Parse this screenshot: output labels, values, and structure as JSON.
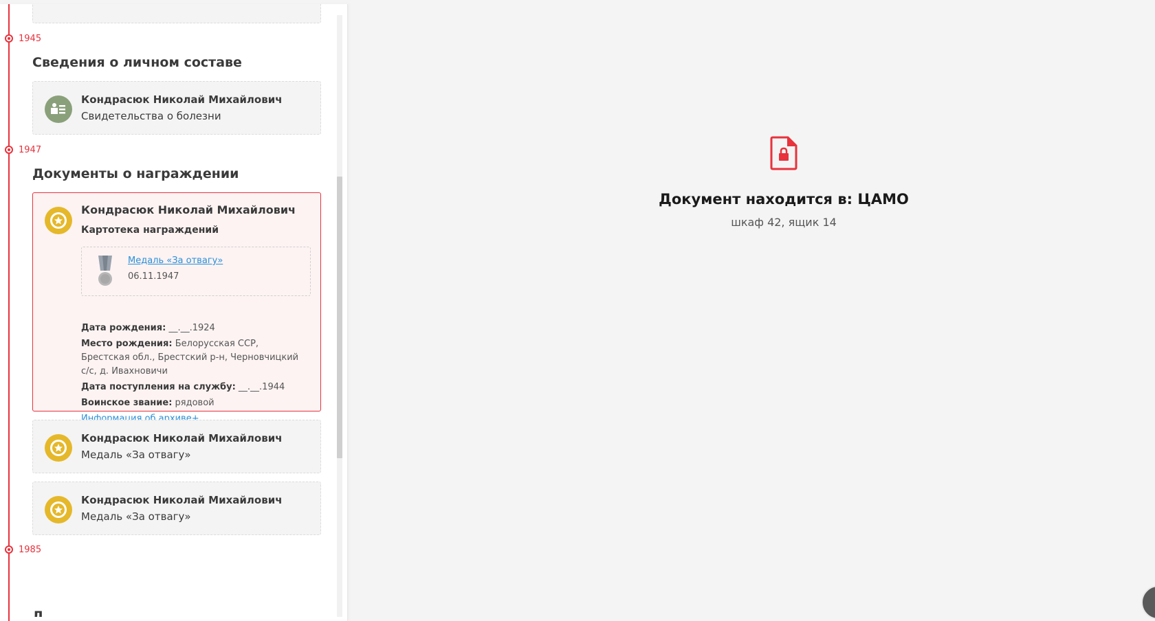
{
  "timeline": {
    "years": [
      "1945",
      "1947",
      "1985"
    ],
    "sections": [
      {
        "title": "Сведения о личном составе",
        "cards": [
          {
            "name": "Кондрасюк Николай Михайлович",
            "subtitle": "Свидетельства о болезни",
            "icon": "person-list-icon"
          }
        ]
      },
      {
        "title": "Документы о награждении",
        "active_card": {
          "name": "Кондрасюк Николай Михайлович",
          "subtitle": "Картотека награждений",
          "award": {
            "title": "Медаль «За отвагу»",
            "date": "06.11.1947"
          },
          "details": [
            {
              "label": "Дата рождения:",
              "value": "__.__.1924"
            },
            {
              "label": "Место рождения:",
              "value": "Белорусская ССР, Брестская обл., Брестский р-н, Черновчицкий с/с, д. Ивахновичи"
            },
            {
              "label": "Дата поступления на службу:",
              "value": "__.__.1944"
            },
            {
              "label": "Воинское звание:",
              "value": "рядовой"
            }
          ],
          "archive_link": "Информация об архиве+"
        },
        "cards": [
          {
            "name": "Кондрасюк Николай Михайлович",
            "subtitle": "Медаль «За отвагу»",
            "icon": "medal-icon"
          },
          {
            "name": "Кондрасюк Николай Михайлович",
            "subtitle": "Медаль «За отвагу»",
            "icon": "medal-icon"
          }
        ]
      }
    ]
  },
  "document": {
    "title": "Документ находится в: ЦАМО",
    "location": "шкаф 42, ящик 14",
    "icon": "locked-file-icon"
  },
  "colors": {
    "accent": "#e8323c",
    "medal": "#e5b82a",
    "person_icon": "#8aa07a",
    "link": "#2a8fd8"
  }
}
